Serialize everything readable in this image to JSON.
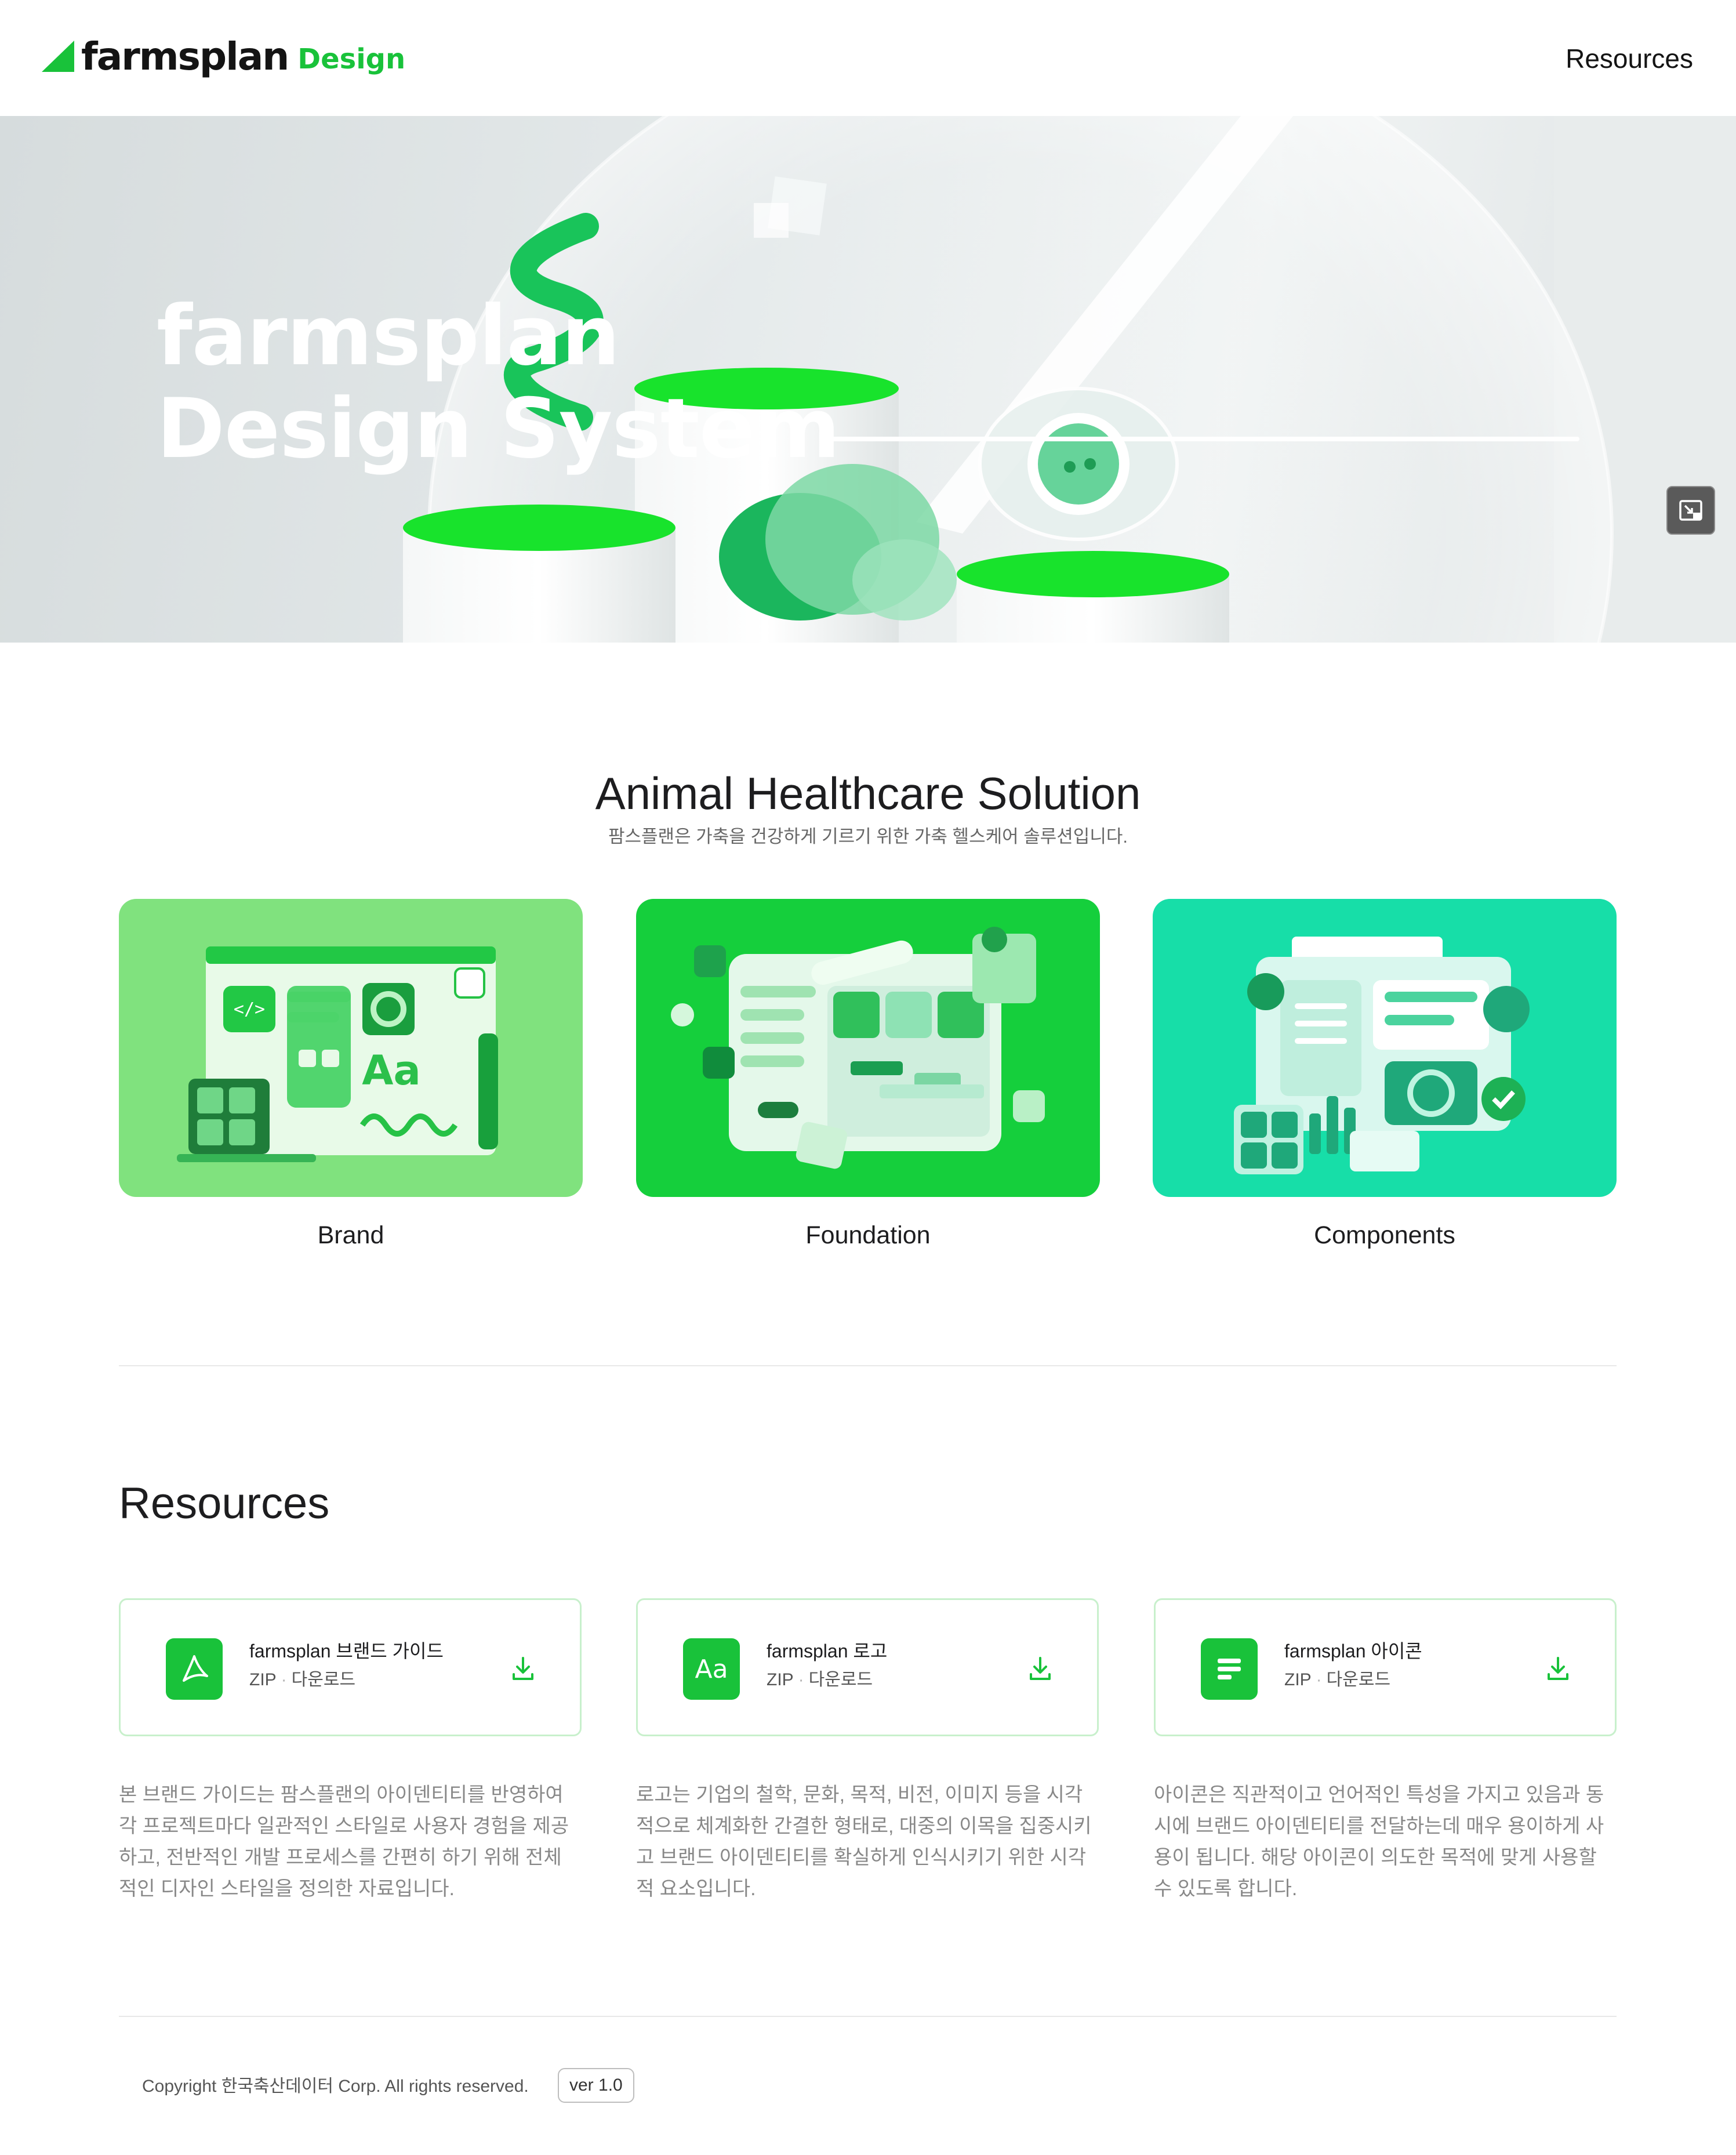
{
  "header": {
    "logo_word": "farmsplan",
    "logo_suffix": "Design",
    "nav_resources": "Resources"
  },
  "hero": {
    "title": "farmsplan\nDesign System",
    "pip_icon": "picture-in-picture-icon"
  },
  "solution": {
    "title": "Animal Healthcare Solution",
    "subtitle": "팜스플랜은 가축을 건강하게 기르기 위한 가축 헬스케어 솔루션입니다.",
    "cards": [
      {
        "label": "Brand",
        "color": "#80e27e"
      },
      {
        "label": "Foundation",
        "color": "#15cf3c"
      },
      {
        "label": "Components",
        "color": "#17dea8"
      }
    ]
  },
  "resources": {
    "title": "Resources",
    "items": [
      {
        "name": "farmsplan 브랜드 가이드",
        "format": "ZIP",
        "action": "다운로드",
        "icon": "pdf-icon",
        "description": "본 브랜드 가이드는 팜스플랜의 아이덴티티를 반영하여 각 프로젝트마다 일관적인 스타일로 사용자 경험을 제공하고, 전반적인 개발 프로세스를 간편히 하기 위해 전체적인 디자인 스타일을 정의한 자료입니다."
      },
      {
        "name": "farmsplan 로고",
        "format": "ZIP",
        "action": "다운로드",
        "icon": "font-icon",
        "icon_text": "Aa",
        "description": "로고는 기업의 철학, 문화, 목적, 비전, 이미지 등을 시각적으로 체계화한 간결한 형태로, 대중의 이목을 집중시키고 브랜드 아이덴티티를 확실하게 인식시키기 위한 시각적 요소입니다."
      },
      {
        "name": "farmsplan 아이콘",
        "format": "ZIP",
        "action": "다운로드",
        "icon": "document-icon",
        "description": "아이콘은 직관적이고 언어적인 특성을 가지고 있음과 동시에 브랜드 아이덴티티를 전달하는데 매우 용이하게 사용이 됩니다. 해당 아이콘이 의도한 목적에 맞게 사용할 수 있도록 합니다."
      }
    ]
  },
  "footer": {
    "copyright": "Copyright 한국축산데이터 Corp. All rights reserved.",
    "version": "ver 1.0"
  },
  "colors": {
    "brand_green": "#19c23a",
    "text": "#1d1d1f",
    "muted": "#888888"
  }
}
